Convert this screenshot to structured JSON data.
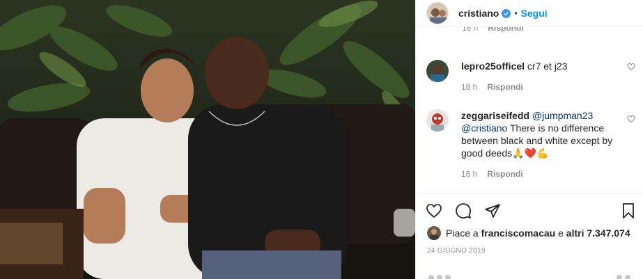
{
  "post": {
    "username": "cristiano",
    "separator": "•",
    "follow_label": "Segui",
    "verified": true
  },
  "partial_comment": {
    "time": "18 h",
    "reply_label": "Rispondi"
  },
  "comments": [
    {
      "username": "lepro25officel",
      "text": "cr7 et j23",
      "time": "18 h",
      "reply_label": "Rispondi"
    },
    {
      "username": "zeggariseifedd",
      "mention1": "@jumpman23",
      "mention2": "@cristiano",
      "text": " There is no difference between black and white except by good deeds🙏❤️💪",
      "time": "16 h",
      "reply_label": "Rispondi"
    }
  ],
  "likes": {
    "prefix": "Piace a",
    "user": "franciscomacau",
    "connector": "e",
    "others": "altri 7.347.074"
  },
  "date": "24 GIUGNO 2019",
  "icons": {
    "like": "heart-icon",
    "comment": "speech-bubble-icon",
    "share": "paper-plane-icon",
    "save": "bookmark-icon"
  },
  "colors": {
    "link": "#0095f6",
    "verified": "#3897f0",
    "muted": "#8e8e8e",
    "mention": "#00376b"
  }
}
